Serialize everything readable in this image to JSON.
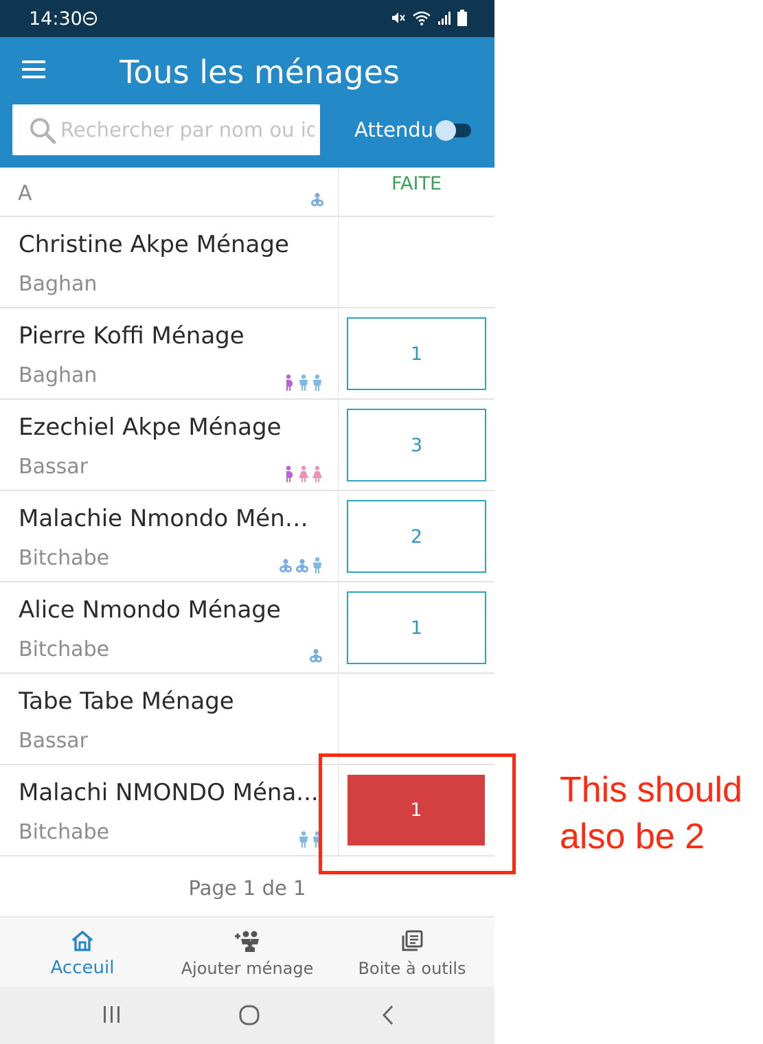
{
  "status_bar": {
    "time": "14:30",
    "icons": [
      "do-not-disturb-icon",
      "mute-icon",
      "wifi-icon",
      "signal-icon",
      "battery-icon"
    ]
  },
  "header": {
    "menu_icon": "hamburger-menu-icon",
    "title": "Tous les ménages",
    "search": {
      "placeholder": "Rechercher par nom ou id",
      "value": "",
      "icon": "search-icon"
    },
    "toggle": {
      "label": "Attendu",
      "on": false
    }
  },
  "list": {
    "section_letter": "A",
    "section_icons": [
      "baby-icon"
    ],
    "column_header": "FAITE",
    "rows": [
      {
        "name": "Christine Akpe Ménage",
        "village": "Baghan",
        "members": [],
        "task": null
      },
      {
        "name": "Pierre Koffi Ménage",
        "village": "Baghan",
        "members": [
          "pregnant-woman-icon",
          "child-boy-icon",
          "child-boy-icon"
        ],
        "task": "1"
      },
      {
        "name": "Ezechiel Akpe Ménage",
        "village": "Bassar",
        "members": [
          "pregnant-woman-icon",
          "child-girl-icon",
          "child-girl-icon"
        ],
        "task": "3"
      },
      {
        "name": "Malachie Nmondo Ména...",
        "village": "Bitchabe",
        "members": [
          "baby-icon",
          "baby-icon",
          "child-boy-icon"
        ],
        "task": "2"
      },
      {
        "name": "Alice Nmondo Ménage",
        "village": "Bitchabe",
        "members": [
          "baby-icon"
        ],
        "task": "1"
      },
      {
        "name": "Tabe Tabe Ménage",
        "village": "Bassar",
        "members": [],
        "task": null
      },
      {
        "name": "Malachi NMONDO Ména...",
        "village": "Bitchabe",
        "members": [
          "child-boy-icon",
          "child-boy-icon"
        ],
        "task": "1",
        "overdue": true
      }
    ]
  },
  "pagination": {
    "label": "Page 1 de 1"
  },
  "bottom_nav": [
    {
      "label": "Acceuil",
      "icon": "home-icon",
      "active": true
    },
    {
      "label": "Ajouter ménage",
      "icon": "add-family-icon",
      "active": false
    },
    {
      "label": "Boite à outils",
      "icon": "toolbox-icon",
      "active": false
    }
  ],
  "system_nav": [
    "recents-icon",
    "home-circle-icon",
    "back-icon"
  ],
  "annotation": {
    "text": "This should also be 2",
    "color": "#ff2a10"
  },
  "colors": {
    "status_bar": "#0f3650",
    "app_bar": "#2389c7",
    "task_border": "#2fa3c0",
    "overdue_task": "#d44040",
    "done_header": "#3aa35a",
    "nav_active": "#2a86c5"
  }
}
